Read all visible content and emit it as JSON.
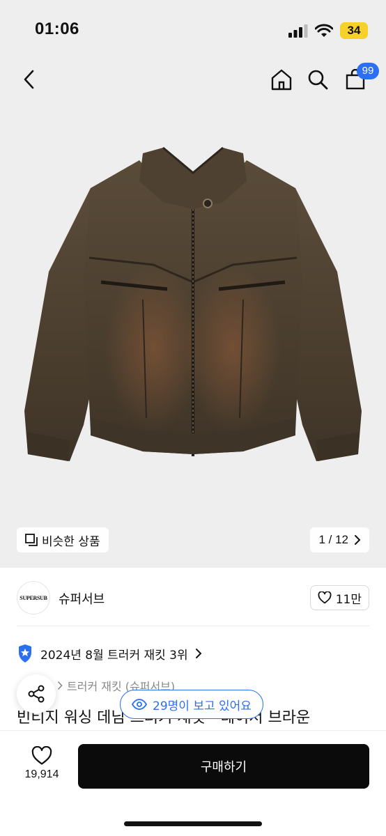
{
  "status_bar": {
    "time": "01:06",
    "battery": "34"
  },
  "nav": {
    "cart_count": "99",
    "icons": [
      "back-chevron-icon",
      "home-icon",
      "search-icon",
      "shopping-bag-icon"
    ]
  },
  "hero": {
    "similar_label": "비슷한 상품",
    "page_counter": "1 / 12"
  },
  "brand": {
    "logo_text": "SUPERSUB",
    "name": "슈퍼서브",
    "like_count": "11만"
  },
  "ranking": {
    "text": "2024년 8월 트러커 재킷 3위"
  },
  "breadcrumb": {
    "category": "트러커 재킷 (슈퍼서브)"
  },
  "product": {
    "title": "빈티지 워싱 데님 트러커 재킷 - 레이서 브라운"
  },
  "viewers": {
    "text": "29명이 보고 있어요"
  },
  "bottom_bar": {
    "wish_count": "19,914",
    "buy_label": "구매하기"
  },
  "colors": {
    "accent": "#2b6ff2",
    "buy_button": "#0b0b0b",
    "battery": "#f6d12a",
    "hero_bg": "#eeeeee"
  }
}
